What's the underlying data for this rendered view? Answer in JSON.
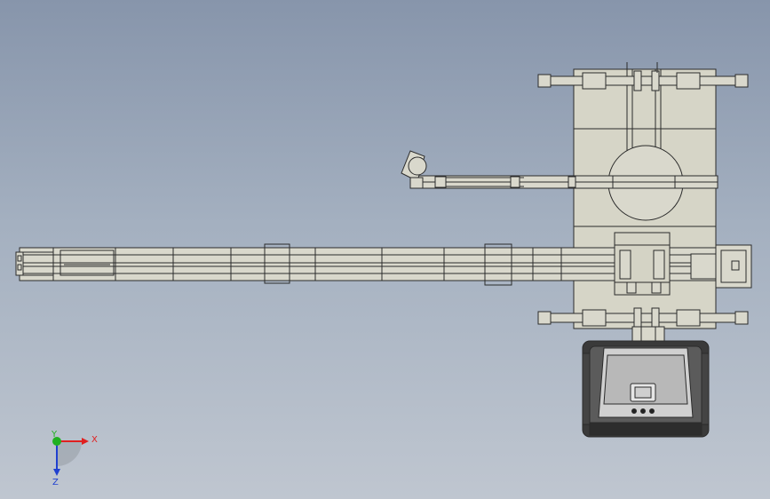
{
  "view": {
    "background_top": "#8795ab",
    "background_bottom": "#bfc6d0",
    "part_fill": "#d9d8cc",
    "line_color": "#2b2b2b"
  },
  "triad": {
    "x_label": "X",
    "y_label": "Y",
    "z_label": "Z",
    "x_color": "#e02020",
    "y_color": "#20b020",
    "z_color": "#2040d0"
  }
}
